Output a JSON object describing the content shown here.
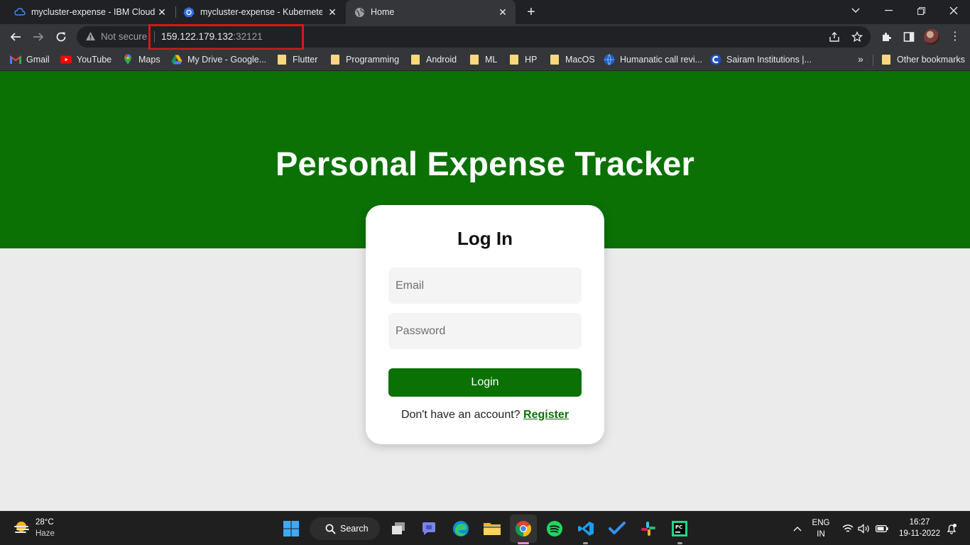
{
  "browser": {
    "tabs": [
      {
        "title": "mycluster-expense - IBM Cloud",
        "icon": "ibm-cloud-icon",
        "active": false
      },
      {
        "title": "mycluster-expense - Kubernetes",
        "icon": "kubernetes-icon",
        "active": false
      },
      {
        "title": "Home",
        "icon": "globe-icon",
        "active": true
      }
    ],
    "address": {
      "security_label": "Not secure",
      "host": "159.122.179.132",
      "port": ":32121"
    },
    "bookmarks": [
      {
        "label": "Gmail",
        "icon": "gmail-icon"
      },
      {
        "label": "YouTube",
        "icon": "youtube-icon"
      },
      {
        "label": "Maps",
        "icon": "maps-icon"
      },
      {
        "label": "My Drive - Google...",
        "icon": "drive-icon"
      },
      {
        "label": "Flutter",
        "icon": "folder-icon"
      },
      {
        "label": "Programming",
        "icon": "folder-icon"
      },
      {
        "label": "Android",
        "icon": "folder-icon"
      },
      {
        "label": "ML",
        "icon": "folder-icon"
      },
      {
        "label": "HP",
        "icon": "folder-icon"
      },
      {
        "label": "MacOS",
        "icon": "folder-icon"
      },
      {
        "label": "Humanatic call revi...",
        "icon": "humanatic-icon"
      },
      {
        "label": "Sairam Institutions |...",
        "icon": "sairam-icon"
      }
    ],
    "bookmarks_more": "»",
    "other_bookmarks": "Other bookmarks"
  },
  "page": {
    "hero_title": "Personal Expense Tracker",
    "login_title": "Log In",
    "email_placeholder": "Email",
    "password_placeholder": "Password",
    "login_button": "Login",
    "register_prompt": "Don't have an account?",
    "register_link": "Register"
  },
  "taskbar": {
    "weather_temp": "28°C",
    "weather_desc": "Haze",
    "search_label": "Search",
    "language_top": "ENG",
    "language_bottom": "IN",
    "time": "16:27",
    "date": "19-11-2022"
  },
  "colors": {
    "brand_green": "#0b7105",
    "page_bg": "#ebebeb",
    "url_highlight": "#d9161c"
  }
}
